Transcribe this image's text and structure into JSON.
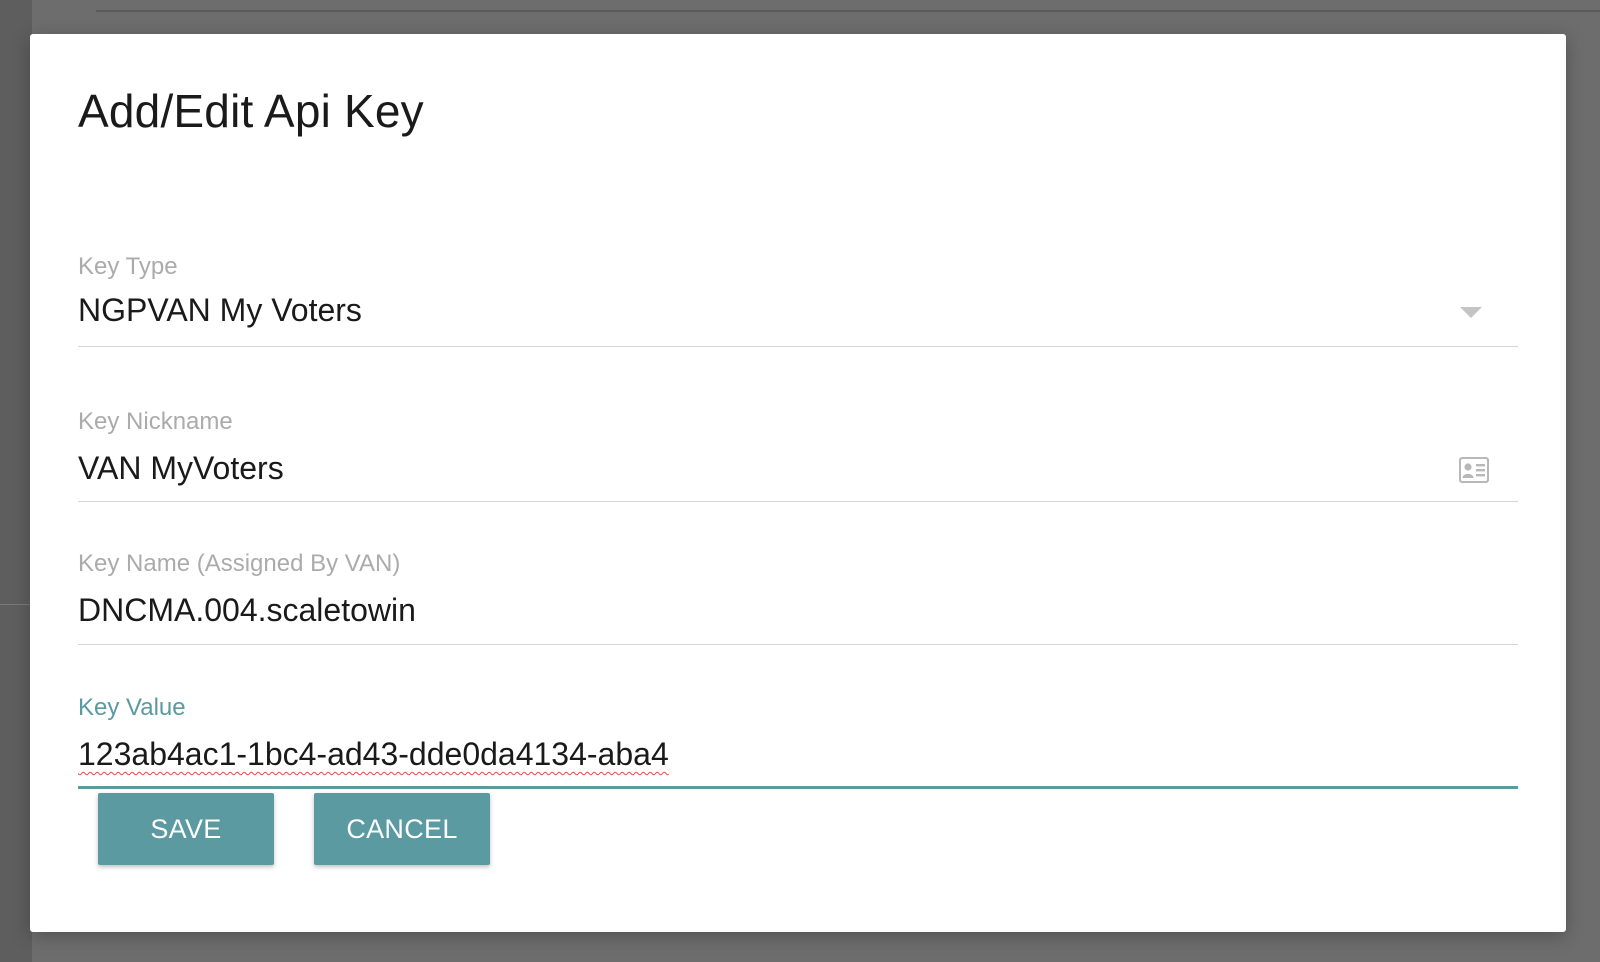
{
  "dialog": {
    "title": "Add/Edit Api Key"
  },
  "fields": {
    "key_type": {
      "label": "Key Type",
      "value": "NGPVAN My Voters"
    },
    "key_nickname": {
      "label": "Key Nickname",
      "value": "VAN MyVoters"
    },
    "key_name": {
      "label": "Key Name (Assigned By VAN)",
      "value": "DNCMA.004.scaletowin"
    },
    "key_value": {
      "label": "Key Value",
      "value": "123ab4ac1-1bc4-ad43-dde0da4134-aba4"
    }
  },
  "buttons": {
    "save_label": "SAVE",
    "cancel_label": "CANCEL"
  },
  "icons": {
    "dropdown": "chevron-down-icon",
    "contact_card": "contact-card-icon"
  },
  "colors": {
    "accent": "#5a9aa0",
    "backdrop": "#6d6d6d",
    "label": "#ababab",
    "spellcheck": "#e04848"
  }
}
